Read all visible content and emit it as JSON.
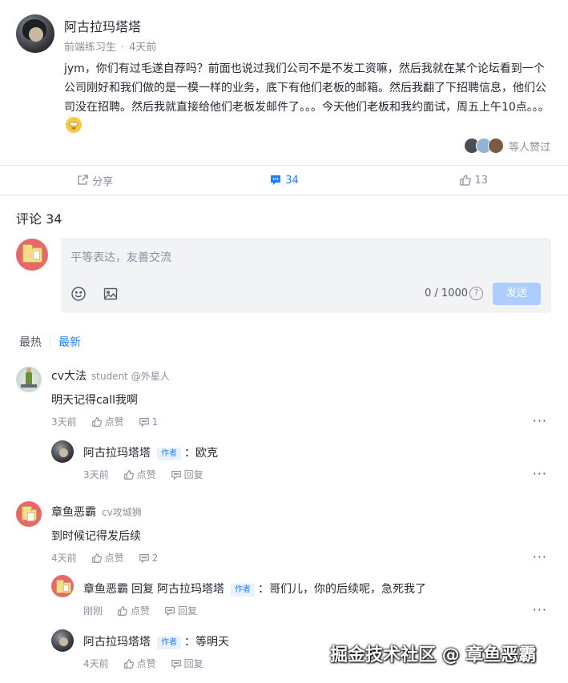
{
  "post": {
    "author_name": "阿古拉玛塔塔",
    "author_title": "前端练习生",
    "meta_dot": "·",
    "time": "4天前",
    "content": "jym，你们有过毛遂自荐吗？前面也说过我们公司不是不发工资嘛，然后我就在某个论坛看到一个公司刚好和我们做的是一模一样的业务，底下有他们老板的邮箱。然后我翻了下招聘信息，他们公司没在招聘。然后我就直接给他们老板发邮件了。。。今天他们老板和我约面试，周五上午10点。。。",
    "likers_text": "等人赞过"
  },
  "actions": {
    "share_label": "分享",
    "comment_count": "34",
    "like_count": "13"
  },
  "comments_header": "评论 34",
  "editor": {
    "placeholder": "平等表达，友善交流",
    "counter": "0 / 1000",
    "help": "?",
    "send_label": "发送"
  },
  "sort_tabs": {
    "hot": "最热",
    "new": "最新"
  },
  "comments": [
    {
      "name": "cv大法",
      "title": "student @外星人",
      "text": "明天记得call我啊",
      "time": "3天前",
      "like": "点赞",
      "reply_count": "1",
      "more": "···"
    },
    {
      "name": "阿古拉玛塔塔",
      "badge": "作者",
      "text": "：欧克",
      "time": "3天前",
      "like": "点赞",
      "reply": "回复",
      "more": "···"
    },
    {
      "name": "章鱼恶霸",
      "title": "cv攻城狮",
      "text": "到时候记得发后续",
      "time": "4天前",
      "like": "点赞",
      "reply_count": "2",
      "more": "···"
    },
    {
      "name": "章鱼恶霸",
      "reply_word": "回复",
      "target": "阿古拉玛塔塔",
      "badge": "作者",
      "text": "：哥们儿，你的后续呢，急死我了",
      "time": "刚刚",
      "like": "点赞",
      "reply": "回复",
      "more": "···"
    },
    {
      "name": "阿古拉玛塔塔",
      "badge": "作者",
      "text": "：等明天",
      "time": "4天前",
      "like": "点赞",
      "reply": "回复",
      "more": "···"
    }
  ],
  "watermark": "掘金技术社区 @ 章鱼恶霸"
}
